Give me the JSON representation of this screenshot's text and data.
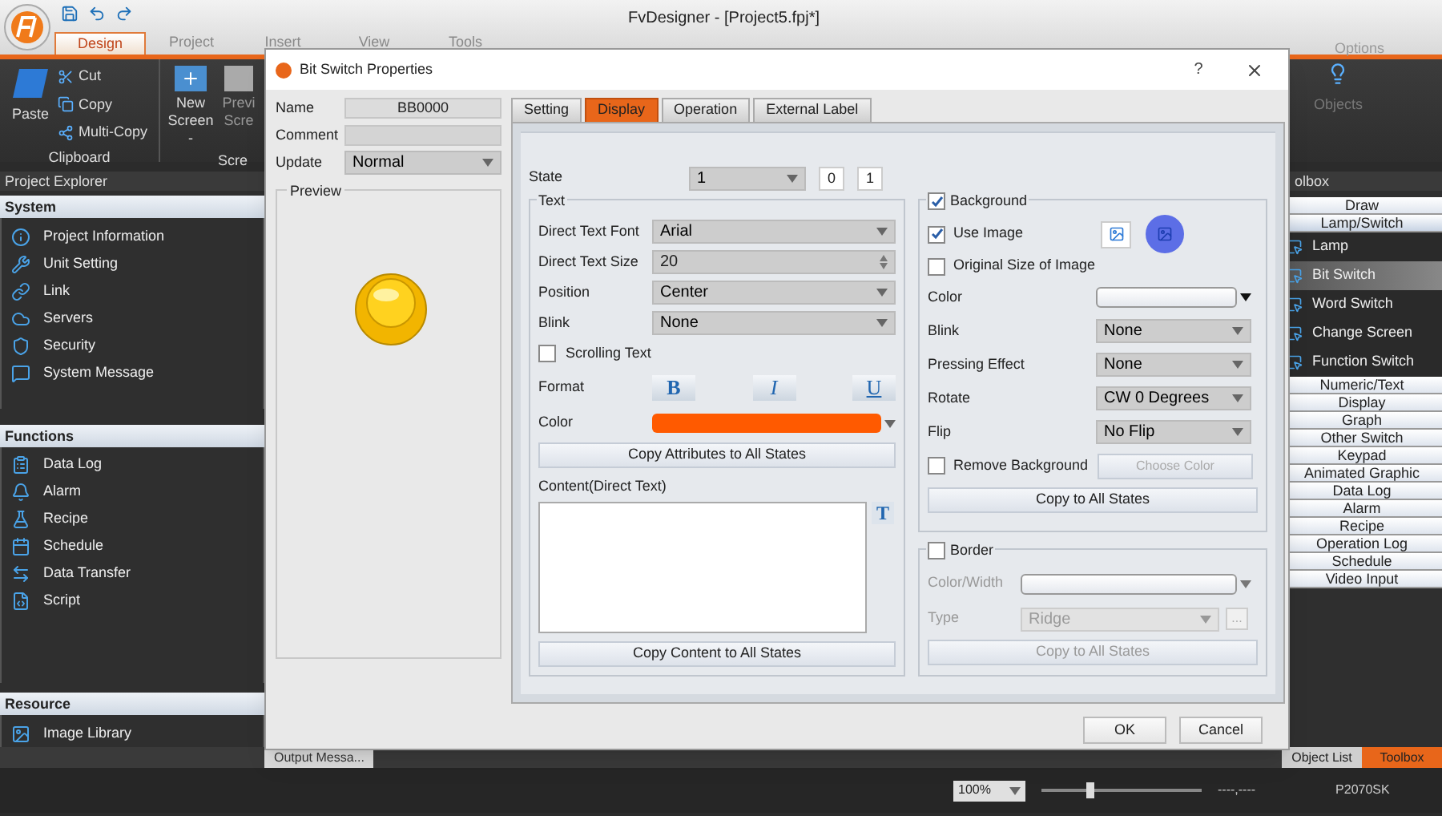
{
  "app": {
    "title": "FvDesigner - [Project5.fpj*]",
    "ribbon_tabs": [
      {
        "label": "Design",
        "selected": true
      },
      {
        "label": "Project",
        "selected": false
      },
      {
        "label": "Insert",
        "selected": false
      },
      {
        "label": "View",
        "selected": false
      },
      {
        "label": "Tools",
        "selected": false
      }
    ],
    "options": "Options",
    "clipboard": {
      "paste": "Paste",
      "cut": "Cut",
      "copy": "Copy",
      "multi_copy": "Multi-Copy",
      "group": "Clipboard"
    },
    "screen": {
      "new": "New Screen -",
      "preview": "Previ Scre",
      "group": "Scre"
    },
    "objects": "Objects"
  },
  "explorer": {
    "title": "Project Explorer",
    "sections": [
      {
        "title": "System",
        "items": [
          "Project Information",
          "Unit Setting",
          "Link",
          "Servers",
          "Security",
          "System Message"
        ]
      },
      {
        "title": "Functions",
        "items": [
          "Data Log",
          "Alarm",
          "Recipe",
          "Schedule",
          "Data Transfer",
          "Script"
        ]
      },
      {
        "title": "Resource",
        "items": [
          "Image Library"
        ]
      }
    ],
    "bottom_tabs": [
      {
        "label": "Output Messa...",
        "selected": false
      }
    ]
  },
  "toolbox": {
    "title": "olbox",
    "categories": [
      {
        "label": "Draw",
        "expanded": false
      },
      {
        "label": "Lamp/Switch",
        "expanded": true,
        "children": [
          {
            "label": "Lamp",
            "selected": false
          },
          {
            "label": "Bit Switch",
            "selected": true
          },
          {
            "label": "Word Switch",
            "selected": false
          },
          {
            "label": "Change Screen",
            "selected": false
          },
          {
            "label": "Function Switch",
            "selected": false
          }
        ]
      },
      {
        "label": "Numeric/Text",
        "expanded": false
      },
      {
        "label": "Display",
        "expanded": false
      },
      {
        "label": "Graph",
        "expanded": false
      },
      {
        "label": "Other Switch",
        "expanded": false
      },
      {
        "label": "Keypad",
        "expanded": false
      },
      {
        "label": "Animated Graphic",
        "expanded": false
      },
      {
        "label": "Data Log",
        "expanded": false
      },
      {
        "label": "Alarm",
        "expanded": false
      },
      {
        "label": "Recipe",
        "expanded": false
      },
      {
        "label": "Operation Log",
        "expanded": false
      },
      {
        "label": "Schedule",
        "expanded": false
      },
      {
        "label": "Video Input",
        "expanded": false
      }
    ],
    "bottom_tabs": [
      {
        "label": "Object List",
        "selected": false
      },
      {
        "label": "Toolbox",
        "selected": true
      }
    ]
  },
  "status_bar": {
    "zoom": "100%",
    "zoom_slider": {
      "level": 0.3
    },
    "coords": "----,----",
    "model": "P2070SK"
  },
  "dialog": {
    "title": "Bit Switch Properties",
    "help": "?",
    "name": {
      "label": "Name",
      "value": "BB0000"
    },
    "comment": {
      "label": "Comment"
    },
    "update": {
      "label": "Update",
      "value": "Normal"
    },
    "preview": {
      "label": "Preview"
    },
    "tabs": [
      {
        "label": "Setting",
        "selected": false
      },
      {
        "label": "Display",
        "selected": true
      },
      {
        "label": "Operation",
        "selected": false
      },
      {
        "label": "External Label",
        "selected": false
      }
    ],
    "state": {
      "label": "State",
      "value": "1",
      "buttons": [
        "0",
        "1"
      ]
    },
    "text_group": {
      "title": "Text",
      "rows": [
        {
          "kind": "select",
          "label": "Direct Text Font",
          "value": "Arial"
        },
        {
          "kind": "spin",
          "label": "Direct Text Size",
          "value": "20"
        },
        {
          "kind": "select",
          "label": "Position",
          "value": "Center"
        },
        {
          "kind": "select",
          "label": "Blink",
          "value": "None"
        }
      ],
      "scrolling_text": {
        "label": "Scrolling Text",
        "checked": false
      },
      "format": {
        "label": "Format",
        "buttons": [
          "B",
          "I",
          "U"
        ]
      },
      "color": {
        "label": "Color",
        "color": "#ff5a00"
      },
      "copy_attributes": "Copy Attributes to All States",
      "content": {
        "label": "Content(Direct Text)",
        "text_button": "T"
      },
      "copy_content": "Copy Content to All States"
    },
    "background": {
      "title": "Background",
      "checked": true,
      "use_image": {
        "label": "Use Image",
        "checked": true
      },
      "original_size": {
        "label": "Original Size of Image",
        "checked": false
      },
      "rows": [
        {
          "kind": "color",
          "label": "Color"
        },
        {
          "kind": "select",
          "label": "Blink",
          "value": "None"
        },
        {
          "kind": "select",
          "label": "Pressing Effect",
          "value": "None"
        },
        {
          "kind": "select",
          "label": "Rotate",
          "value": "CW 0 Degrees"
        },
        {
          "kind": "select",
          "label": "Flip",
          "value": "No Flip"
        }
      ],
      "remove_background": {
        "label": "Remove Background",
        "checked": false
      },
      "choose_color": {
        "label": "Choose Color",
        "disabled": true
      },
      "copy": "Copy to All States"
    },
    "border": {
      "title": "Border",
      "checked": false,
      "rows": [
        {
          "kind": "color",
          "label": "Color/Width"
        },
        {
          "kind": "select",
          "label": "Type",
          "value": "Ridge"
        }
      ],
      "more": "...",
      "copy": "Copy to All States"
    },
    "buttons": [
      "OK",
      "Cancel"
    ]
  }
}
